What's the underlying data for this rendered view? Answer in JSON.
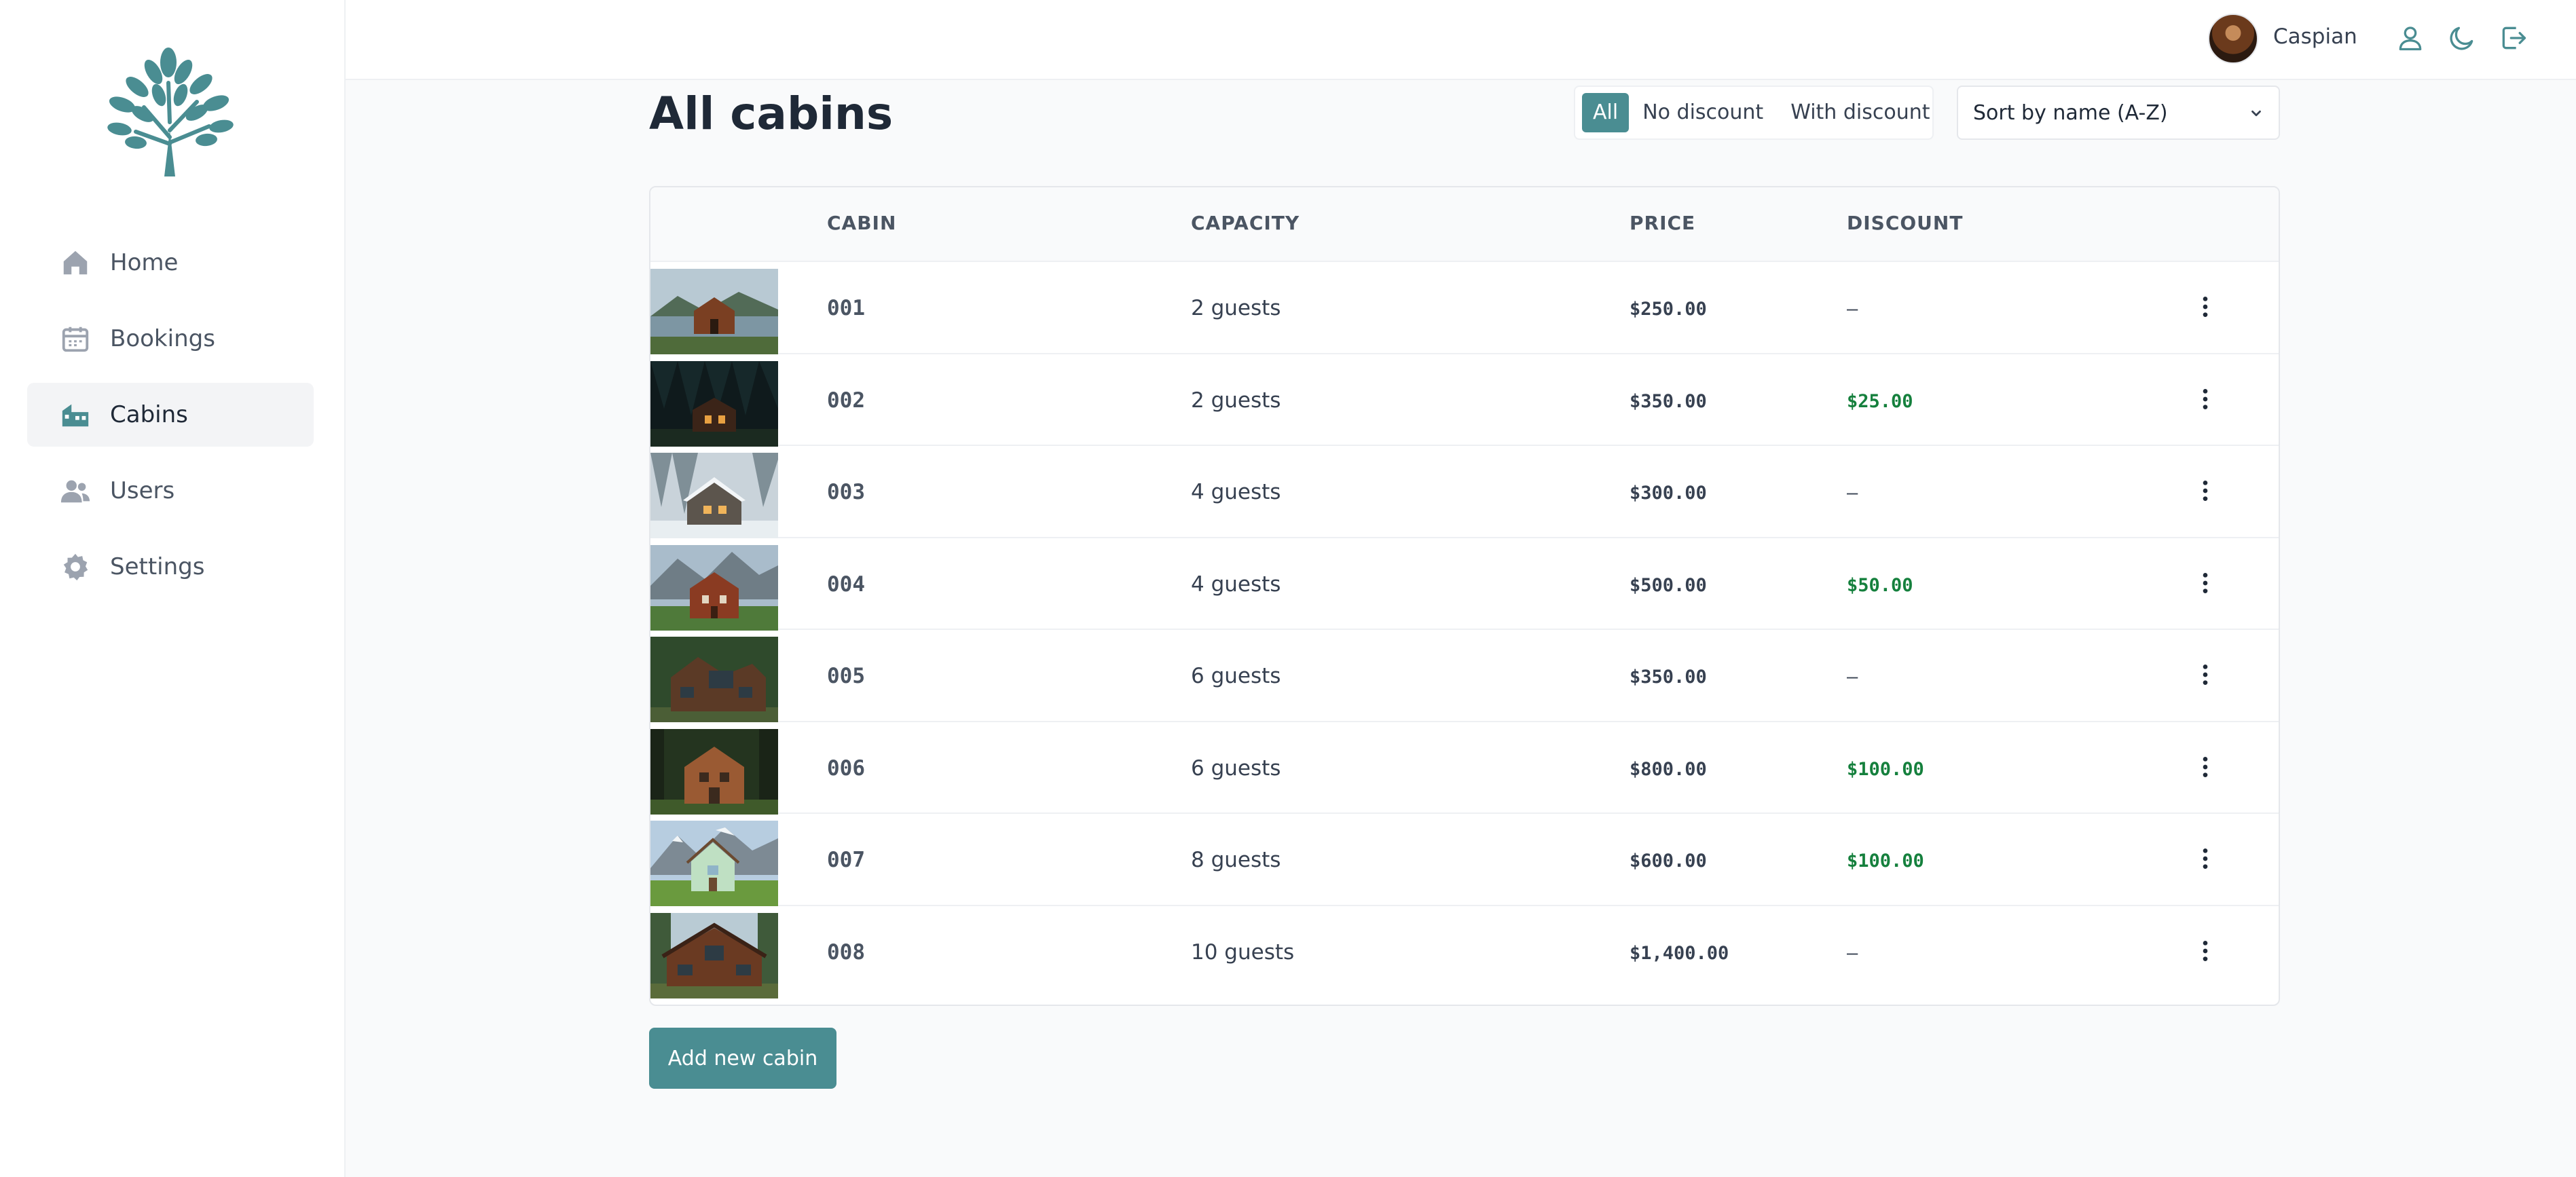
{
  "brand": {
    "accent": "#4a8d92",
    "logo_icon": "tree-icon"
  },
  "sidebar": {
    "items": [
      {
        "label": "Home",
        "icon": "home-icon"
      },
      {
        "label": "Bookings",
        "icon": "calendar-icon"
      },
      {
        "label": "Cabins",
        "icon": "cabins-icon",
        "active": true
      },
      {
        "label": "Users",
        "icon": "users-icon"
      },
      {
        "label": "Settings",
        "icon": "gear-icon"
      }
    ]
  },
  "header": {
    "user_name": "Caspian",
    "icons": [
      "user-icon",
      "moon-icon",
      "logout-icon"
    ]
  },
  "main": {
    "title": "All cabins",
    "filter": {
      "options": [
        "All",
        "No discount",
        "With discount"
      ],
      "selected": "All"
    },
    "sort": {
      "selected": "Sort by name (A-Z)"
    },
    "table": {
      "columns": [
        "CABIN",
        "CAPACITY",
        "PRICE",
        "DISCOUNT"
      ],
      "rows": [
        {
          "name": "001",
          "capacity": "2 guests",
          "price": "$250.00",
          "discount": "—"
        },
        {
          "name": "002",
          "capacity": "2 guests",
          "price": "$350.00",
          "discount": "$25.00"
        },
        {
          "name": "003",
          "capacity": "4 guests",
          "price": "$300.00",
          "discount": "—"
        },
        {
          "name": "004",
          "capacity": "4 guests",
          "price": "$500.00",
          "discount": "$50.00"
        },
        {
          "name": "005",
          "capacity": "6 guests",
          "price": "$350.00",
          "discount": "—"
        },
        {
          "name": "006",
          "capacity": "6 guests",
          "price": "$800.00",
          "discount": "$100.00"
        },
        {
          "name": "007",
          "capacity": "8 guests",
          "price": "$600.00",
          "discount": "$100.00"
        },
        {
          "name": "008",
          "capacity": "10 guests",
          "price": "$1,400.00",
          "discount": "—"
        }
      ]
    },
    "add_button": "Add new cabin"
  }
}
